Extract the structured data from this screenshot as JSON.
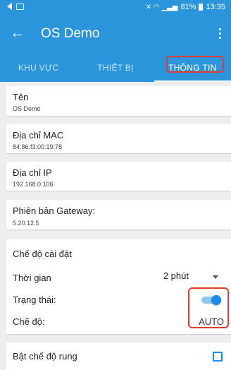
{
  "statusbar": {
    "time": "13:35",
    "battery": "81%"
  },
  "appbar": {
    "back_icon": "←",
    "title": "OS Demo"
  },
  "tabs": [
    {
      "label": "KHU VỰC",
      "active": false
    },
    {
      "label": "THIẾT BỊ",
      "active": false
    },
    {
      "label": "THÔNG TIN",
      "active": true
    }
  ],
  "info": [
    {
      "label": "Tên",
      "value": "OS Demo"
    },
    {
      "label": "Địa chỉ MAC",
      "value": "84:86:f3:00:19:78"
    },
    {
      "label": "Địa chỉ IP",
      "value": "192.168.0.106"
    },
    {
      "label": "Phiên bản Gateway:",
      "value": "5.20.12.5"
    }
  ],
  "settings": {
    "section_title": "Chế độ cài đặt",
    "time_label": "Thời gian",
    "time_value": "2 phút",
    "status_label": "Trạng thái:",
    "status_on": true,
    "mode_label": "Chế độ:",
    "mode_value": "AUTO"
  },
  "vibration": {
    "label": "Bật chế độ rung",
    "checked": false
  },
  "colors": {
    "primary": "#2b95db",
    "accent": "#1e88e5",
    "highlight": "#e53935"
  }
}
